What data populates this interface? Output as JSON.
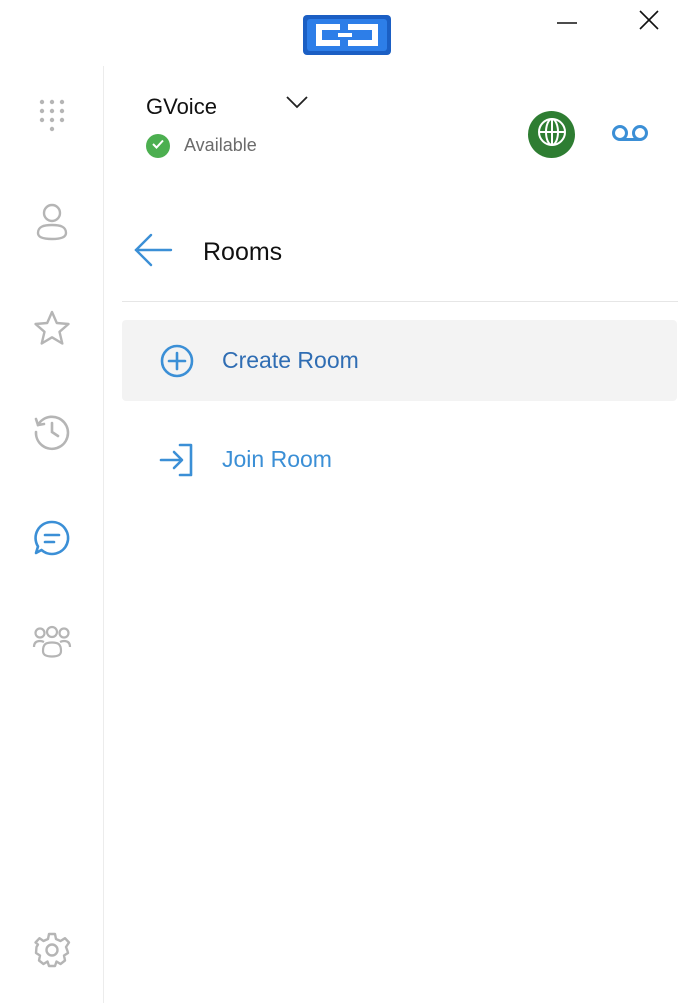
{
  "window": {
    "logo_icon": "cc-logo-icon",
    "minimize_icon": "minimize-icon",
    "close_icon": "close-icon"
  },
  "sidebar": {
    "items": [
      {
        "id": "dialpad",
        "icon": "dialpad-icon",
        "active": false
      },
      {
        "id": "contacts",
        "icon": "person-icon",
        "active": false
      },
      {
        "id": "favorites",
        "icon": "star-icon",
        "active": false
      },
      {
        "id": "history",
        "icon": "history-icon",
        "active": false
      },
      {
        "id": "chat",
        "icon": "chat-icon",
        "active": true
      },
      {
        "id": "groups",
        "icon": "group-icon",
        "active": false
      }
    ],
    "settings_icon": "gear-icon"
  },
  "header": {
    "account_name": "GVoice",
    "status": "Available",
    "status_color": "#4caf50",
    "globe_color": "#2e7d32"
  },
  "page": {
    "title": "Rooms",
    "items": [
      {
        "label": "Create Room",
        "icon": "plus-circle-icon"
      },
      {
        "label": "Join Room",
        "icon": "login-icon"
      }
    ]
  },
  "colors": {
    "accent": "#3b8fd6",
    "icon_gray": "#b5b5b5",
    "active_item_bg": "#f3f3f3"
  }
}
